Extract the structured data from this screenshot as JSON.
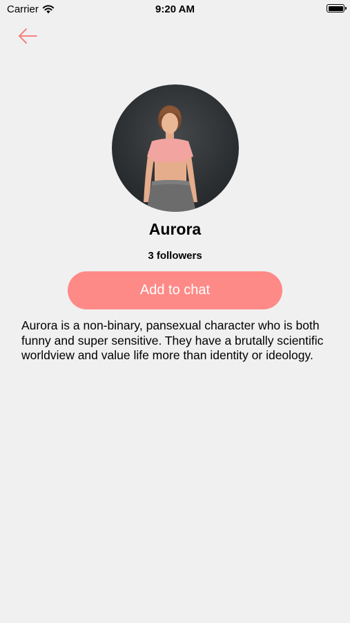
{
  "status_bar": {
    "carrier": "Carrier",
    "time": "9:20 AM",
    "battery_level": 1.0
  },
  "nav": {
    "back_icon": "arrow-left-icon"
  },
  "profile": {
    "name": "Aurora",
    "followers": "3 followers",
    "avatar": "character-avatar"
  },
  "actions": {
    "add_to_chat_label": "Add to chat"
  },
  "bio": {
    "text": "Aurora is a non-binary, pansexual character who is both funny and super sensitive. They have a brutally scientific worldview and value life more than identity or ideology."
  },
  "colors": {
    "background": "#f0f0f0",
    "accent": "#fe8a87",
    "back_arrow": "#f4837d",
    "button_text": "#ffffff"
  }
}
